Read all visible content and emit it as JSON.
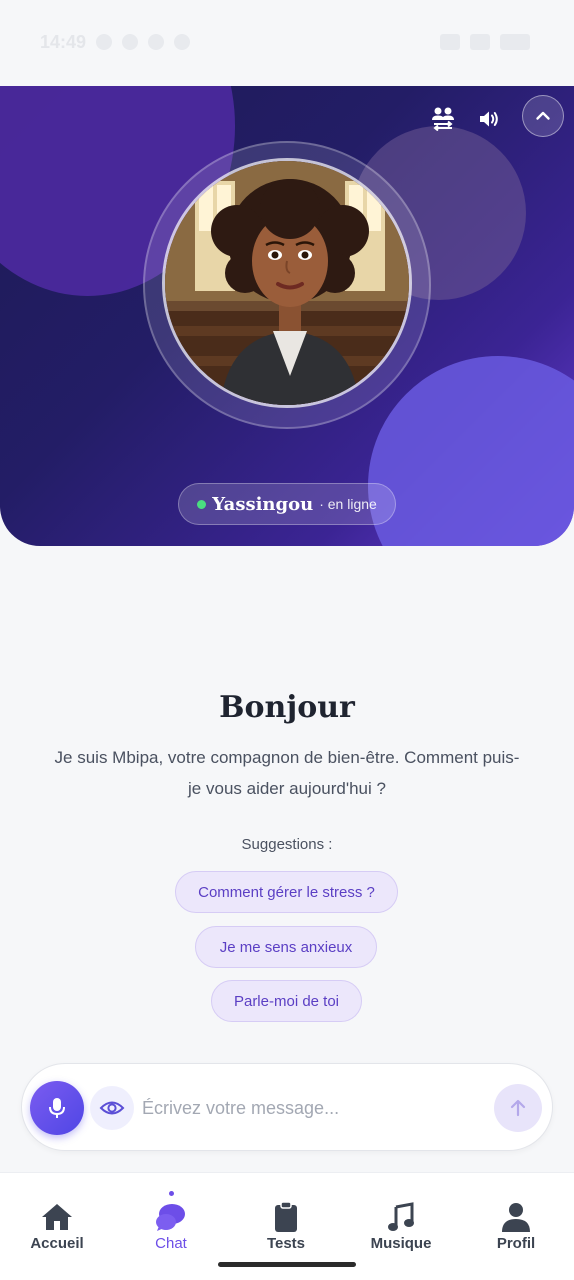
{
  "status_bar": {
    "time": "14:49"
  },
  "hero": {
    "companion_name": "Yassingou",
    "companion_status": "· en ligne",
    "colors": {
      "online_dot": "#4ade80",
      "gradient_start": "#1e1b56",
      "gradient_end": "#6a3fd6"
    }
  },
  "welcome": {
    "title": "Bonjour",
    "message": "Je suis Mbipa, votre compagnon de bien-être. Comment puis-je vous aider aujourd'hui ?",
    "suggestions_label": "Suggestions :",
    "suggestions": [
      "Comment gérer le stress ?",
      "Je me sens anxieux",
      "Parle-moi de toi"
    ]
  },
  "composer": {
    "placeholder": "Écrivez votre message...",
    "value": ""
  },
  "nav": {
    "items": [
      {
        "label": "Accueil",
        "icon": "home-icon"
      },
      {
        "label": "Chat",
        "icon": "chat-icon",
        "active": true
      },
      {
        "label": "Tests",
        "icon": "clipboard-icon"
      },
      {
        "label": "Musique",
        "icon": "music-icon"
      },
      {
        "label": "Profil",
        "icon": "user-icon"
      }
    ],
    "accent": "#6d4ee8"
  }
}
